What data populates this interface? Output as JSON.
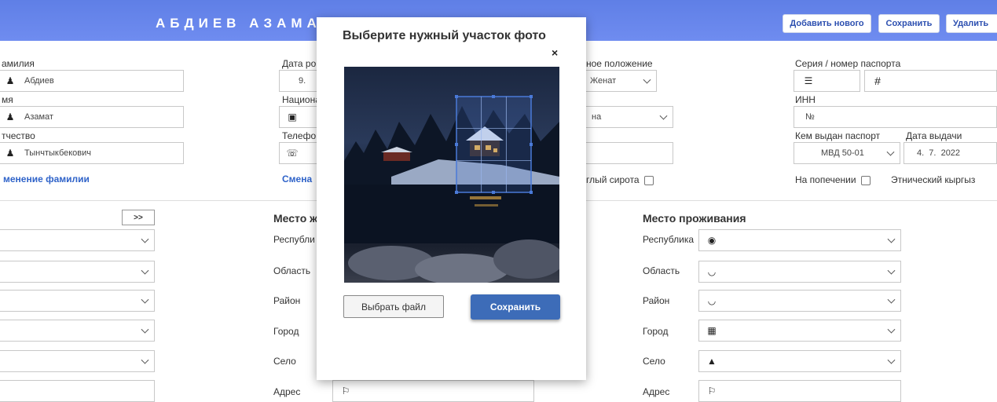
{
  "header": {
    "title": "АБДИЕВ АЗАМАТ",
    "add_new": "Добавить нового",
    "save": "Сохранить",
    "delete": "Удалить"
  },
  "col1": {
    "surname_label": "амилия",
    "surname_value": "Абдиев",
    "name_label": "мя",
    "name_value": "Азамат",
    "patronymic_label": "тчество",
    "patronymic_value": "Тынчтыкбекович",
    "change_surname_link": "менение фамилии"
  },
  "col2": {
    "birthdate_label": "Дата ро",
    "birthdate_value": "9.",
    "nationality_label": "Национа",
    "phone_label": "Телефо",
    "change_link": "Смена"
  },
  "col3": {
    "marital_label": "ное положение",
    "marital_value": "Женат",
    "country_value": "на",
    "orphan_label": "глый сирота"
  },
  "col4": {
    "passport_label": "Серия / номер паспорта",
    "inn_label": "ИНН",
    "inn_placeholder": "№",
    "issued_by_label": "Кем выдан паспорт",
    "issued_by_value": "МВД 50-01",
    "issue_date_label": "Дата выдачи",
    "issue_date_value": "4.  7.  2022",
    "guardianship_label": "На попечении",
    "ethnic_label": "Этнический кыргыз"
  },
  "arrow_button": ">>",
  "reg_section": {
    "title": "Место ж",
    "labels": [
      "Республи",
      "Область",
      "Район",
      "Город",
      "Село",
      "Адрес"
    ]
  },
  "res_section": {
    "title": "Место проживания",
    "labels": [
      "Республика",
      "Область",
      "Район",
      "Город",
      "Село",
      "Адрес"
    ]
  },
  "modal": {
    "title": "Выберите нужный участок фото",
    "close": "×",
    "choose_file": "Выбрать файл",
    "save": "Сохранить"
  }
}
